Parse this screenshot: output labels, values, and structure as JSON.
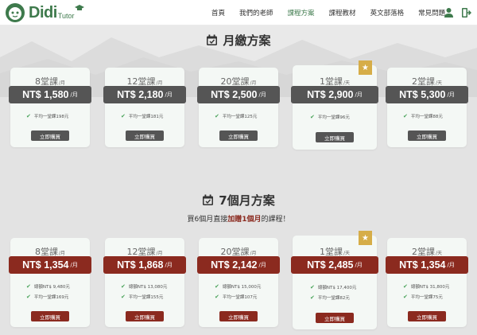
{
  "header": {
    "logo_text": "Didi",
    "logo_sub": "Tutor",
    "nav": [
      "首頁",
      "我們的老師",
      "課程方案",
      "課程教材",
      "英文部落格",
      "常見問題"
    ],
    "active_index": 2
  },
  "monthly": {
    "title": "月繳方案",
    "plans": [
      {
        "count": "8堂課",
        "unit": "/月",
        "price": "NT$ 1,580",
        "per": "/月",
        "feats": [
          "平均一堂課198元"
        ],
        "buy": "立即購買",
        "star": false
      },
      {
        "count": "12堂課",
        "unit": "/月",
        "price": "NT$ 2,180",
        "per": "/月",
        "feats": [
          "平均一堂課181元"
        ],
        "buy": "立即購買",
        "star": false
      },
      {
        "count": "20堂課",
        "unit": "/月",
        "price": "NT$ 2,500",
        "per": "/月",
        "feats": [
          "平均一堂課125元"
        ],
        "buy": "立即購買",
        "star": false
      },
      {
        "count": "1堂課",
        "unit": "/天",
        "price": "NT$ 2,900",
        "per": "/月",
        "feats": [
          "平均一堂課96元"
        ],
        "buy": "立即購買",
        "star": true
      },
      {
        "count": "2堂課",
        "unit": "/天",
        "price": "NT$ 5,300",
        "per": "/月",
        "feats": [
          "平均一堂課88元"
        ],
        "buy": "立即購買",
        "star": false
      }
    ]
  },
  "sevenmonth": {
    "title": "7個月方案",
    "subtitle_pre": "買6個月直接",
    "subtitle_hl": "加贈1個月",
    "subtitle_post": "的課程！",
    "plans": [
      {
        "count": "8堂課",
        "unit": "/月",
        "price": "NT$ 1,354",
        "per": "/月",
        "feats": [
          "總額NT$ 9,480元",
          "平均一堂課169元"
        ],
        "buy": "立即購買",
        "star": false
      },
      {
        "count": "12堂課",
        "unit": "/月",
        "price": "NT$ 1,868",
        "per": "/月",
        "feats": [
          "總額NT$ 13,080元",
          "平均一堂課155元"
        ],
        "buy": "立即購買",
        "star": false
      },
      {
        "count": "20堂課",
        "unit": "/月",
        "price": "NT$ 2,142",
        "per": "/月",
        "feats": [
          "總額NT$ 15,000元",
          "平均一堂課107元"
        ],
        "buy": "立即購買",
        "star": false
      },
      {
        "count": "1堂課",
        "unit": "/天",
        "price": "NT$ 2,485",
        "per": "/月",
        "feats": [
          "總額NT$ 17,400元",
          "平均一堂課82元"
        ],
        "buy": "立即購買",
        "star": true
      },
      {
        "count": "2堂課",
        "unit": "/天",
        "price": "NT$ 1,354",
        "per": "/月",
        "feats": [
          "總額NT$ 31,800元",
          "平均一堂課75元"
        ],
        "buy": "立即購買",
        "star": false
      }
    ]
  },
  "colors": {
    "brand_green": "#3e7a4c",
    "price_gray": "#555555",
    "price_red": "#8b2a1f",
    "star_gold": "#d6ad48"
  }
}
